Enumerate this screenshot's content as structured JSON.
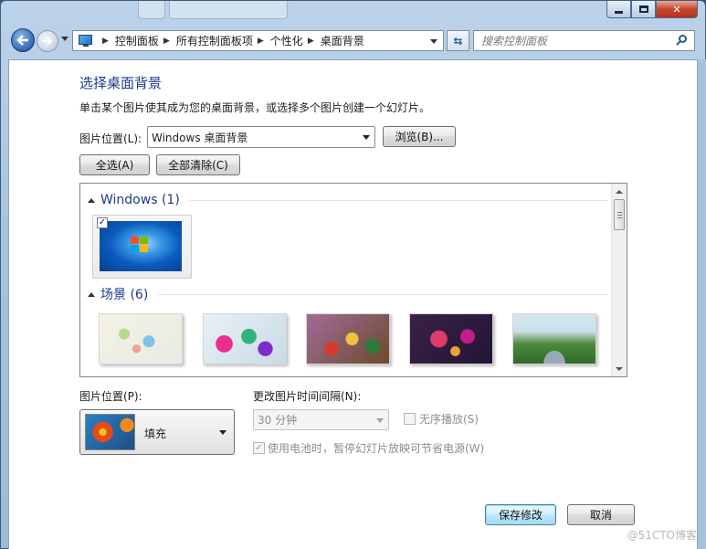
{
  "window": {
    "minimize_glyph": "minimize",
    "maximize_glyph": "maximize",
    "close_label": "✕"
  },
  "nav": {
    "breadcrumb": [
      "控制面板",
      "所有控制面板项",
      "个性化",
      "桌面背景"
    ],
    "search_placeholder": "搜索控制面板"
  },
  "page": {
    "title": "选择桌面背景",
    "subtitle": "单击某个图片使其成为您的桌面背景，或选择多个图片创建一个幻灯片。",
    "location_label": "图片位置(L):",
    "location_value": "Windows 桌面背景",
    "browse_button": "浏览(B)...",
    "select_all_button": "全选(A)",
    "clear_all_button": "全部清除(C)"
  },
  "gallery": {
    "groups": [
      {
        "label": "Windows (1)"
      },
      {
        "label": "场景 (6)"
      }
    ]
  },
  "options": {
    "position_label": "图片位置(P):",
    "position_value": "填充",
    "interval_label": "更改图片时间间隔(N):",
    "interval_value": "30 分钟",
    "shuffle_label": "无序播放(S)",
    "battery_label": "使用电池时，暂停幻灯片放映可节省电源(W)"
  },
  "footer": {
    "save_button": "保存修改",
    "cancel_button": "取消",
    "watermark": "@51CTO博客"
  },
  "colors": {
    "heading": "#1e3a8a",
    "frame": "#a9c3df"
  }
}
